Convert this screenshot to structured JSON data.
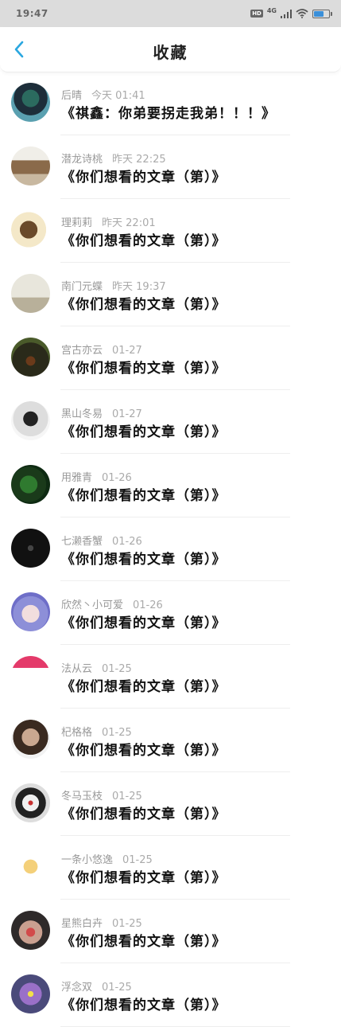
{
  "status_bar": {
    "time": "19:47",
    "hd": "HD",
    "network": "4G",
    "battery_level": 0.7,
    "accent": "#3a8fd9"
  },
  "header": {
    "title": "收藏",
    "back_icon": "chevron-left-icon",
    "back_color": "#2aa7e0"
  },
  "items": [
    {
      "author": "后晴",
      "date": "今天 01:41",
      "title": "《祺鑫：你弟要拐走我弟！！！》"
    },
    {
      "author": "潜龙诗桃",
      "date": "昨天 22:25",
      "title": "《你们想看的文章（第）》"
    },
    {
      "author": "理莉莉",
      "date": "昨天 22:01",
      "title": "《你们想看的文章（第）》"
    },
    {
      "author": "南门元蝶",
      "date": "昨天 19:37",
      "title": "《你们想看的文章（第）》"
    },
    {
      "author": "宫古亦云",
      "date": "01-27",
      "title": "《你们想看的文章（第）》"
    },
    {
      "author": "黑山冬易",
      "date": "01-27",
      "title": "《你们想看的文章（第）》"
    },
    {
      "author": "用雅青",
      "date": "01-26",
      "title": "《你们想看的文章（第）》"
    },
    {
      "author": "七濑香蟹",
      "date": "01-26",
      "title": "《你们想看的文章（第）》"
    },
    {
      "author": "欣然丶小可爱",
      "date": "01-26",
      "title": "《你们想看的文章（第）》"
    },
    {
      "author": "法从云",
      "date": "01-25",
      "title": "《你们想看的文章（第）》"
    },
    {
      "author": "杞格格",
      "date": "01-25",
      "title": "《你们想看的文章（第）》"
    },
    {
      "author": "冬马玉枝",
      "date": "01-25",
      "title": "《你们想看的文章（第）》"
    },
    {
      "author": "一条小悠逸",
      "date": "01-25",
      "title": "《你们想看的文章（第）》"
    },
    {
      "author": "星熊白卉",
      "date": "01-25",
      "title": "《你们想看的文章（第）》"
    },
    {
      "author": "浮念双",
      "date": "01-25",
      "title": "《你们想看的文章（第）》"
    }
  ]
}
